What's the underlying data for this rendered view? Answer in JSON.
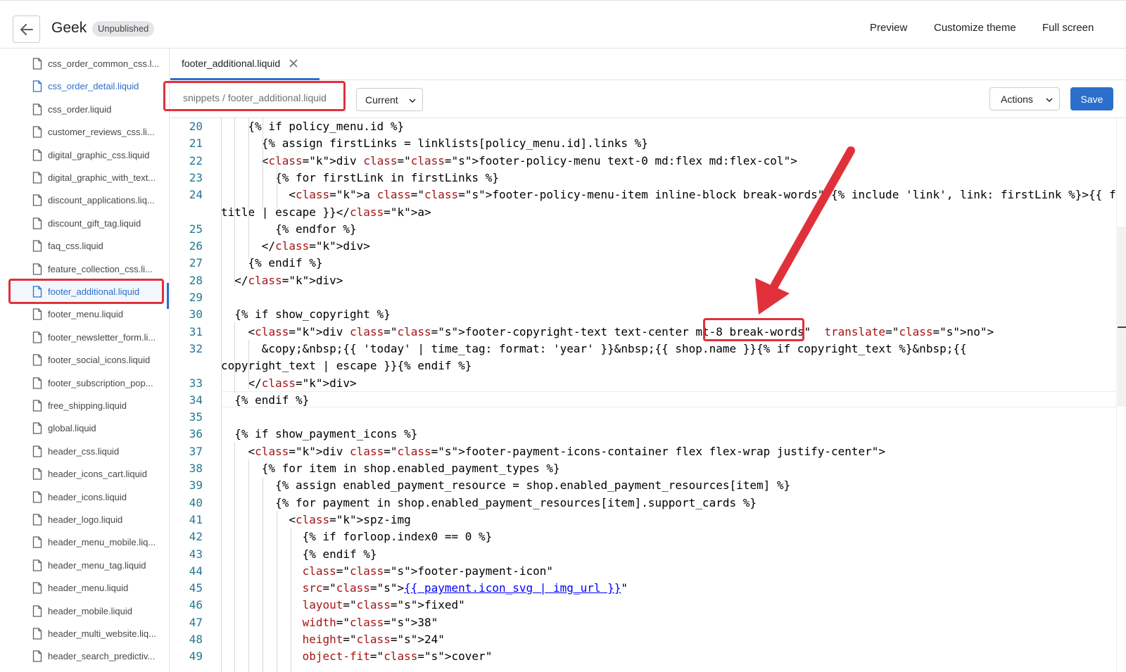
{
  "header": {
    "theme_name": "Geek",
    "status_badge": "Unpublished",
    "actions": [
      "Preview",
      "Customize theme",
      "Full screen"
    ]
  },
  "sidebar": {
    "files": [
      "css_order_common_css.l...",
      "css_order_detail.liquid",
      "css_order.liquid",
      "customer_reviews_css.li...",
      "digital_graphic_css.liquid",
      "digital_graphic_with_text...",
      "discount_applications.liq...",
      "discount_gift_tag.liquid",
      "faq_css.liquid",
      "feature_collection_css.li...",
      "footer_additional.liquid",
      "footer_menu.liquid",
      "footer_newsletter_form.li...",
      "footer_social_icons.liquid",
      "footer_subscription_pop...",
      "free_shipping.liquid",
      "global.liquid",
      "header_css.liquid",
      "header_icons_cart.liquid",
      "header_icons.liquid",
      "header_logo.liquid",
      "header_menu_mobile.liq...",
      "header_menu_tag.liquid",
      "header_menu.liquid",
      "header_mobile.liquid",
      "header_multi_website.liq...",
      "header_search_predictiv..."
    ],
    "active_file": "footer_additional.liquid"
  },
  "tabs": [
    {
      "label": "footer_additional.liquid"
    }
  ],
  "toolbar": {
    "breadcrumb": "snippets / footer_additional.liquid",
    "version": "Current",
    "actions_label": "Actions",
    "save_label": "Save"
  },
  "editor": {
    "line_numbers": [
      "20",
      "21",
      "22",
      "23",
      "24",
      "",
      "25",
      "26",
      "27",
      "28",
      "29",
      "30",
      "31",
      "32",
      "",
      "33",
      "34",
      "35",
      "36",
      "37",
      "38",
      "39",
      "40",
      "41",
      "42",
      "43",
      "44",
      "45",
      "46",
      "47",
      "48",
      "49"
    ],
    "lines": [
      "    {% if policy_menu.id %}",
      "      {% assign firstLinks = linklists[policy_menu.id].links %}",
      "      <div class=\"footer-policy-menu text-0 md:flex md:flex-col\">",
      "        {% for firstLink in firstLinks %}",
      "          <a class=\"footer-policy-menu-item inline-block break-words\" {% include 'link', link: firstLink %}>{{ firstLink.",
      "title | escape }}</a>",
      "        {% endfor %}",
      "      </div>",
      "    {% endif %}",
      "  </div>",
      "",
      "  {% if show_copyright %}",
      "    <div class=\"footer-copyright-text text-center mt-8 break-words\"  translate=\"no\">",
      "      &copy;&nbsp;{{ 'today' | time_tag: format: 'year' }}&nbsp;{{ shop.name }}{% if copyright_text %}&nbsp;{{",
      "copyright_text | escape }}{% endif %}",
      "    </div>",
      "  {% endif %}",
      "",
      "  {% if show_payment_icons %}",
      "    <div class=\"footer-payment-icons-container flex flex-wrap justify-center\">",
      "      {% for item in shop.enabled_payment_types %}",
      "        {% assign enabled_payment_resource = shop.enabled_payment_resources[item] %}",
      "        {% for payment in shop.enabled_payment_resources[item].support_cards %}",
      "          <spz-img",
      "            {% if forloop.index0 == 0 %}",
      "            {% endif %}",
      "            class=\"footer-payment-icon\"",
      "            src=\"{{ payment.icon_svg | img_url }}\"",
      "            layout=\"fixed\"",
      "            width=\"38\"",
      "            height=\"24\"",
      "            object-fit=\"cover\""
    ]
  },
  "colors": {
    "accent": "#2c6ecb",
    "annotation_red": "#e0313a",
    "keyword": "#a31515",
    "string": "#0000ff",
    "line_number": "#237893"
  },
  "icons": [
    "back-arrow-icon",
    "file-icon",
    "close-icon",
    "chevron-down-icon"
  ]
}
